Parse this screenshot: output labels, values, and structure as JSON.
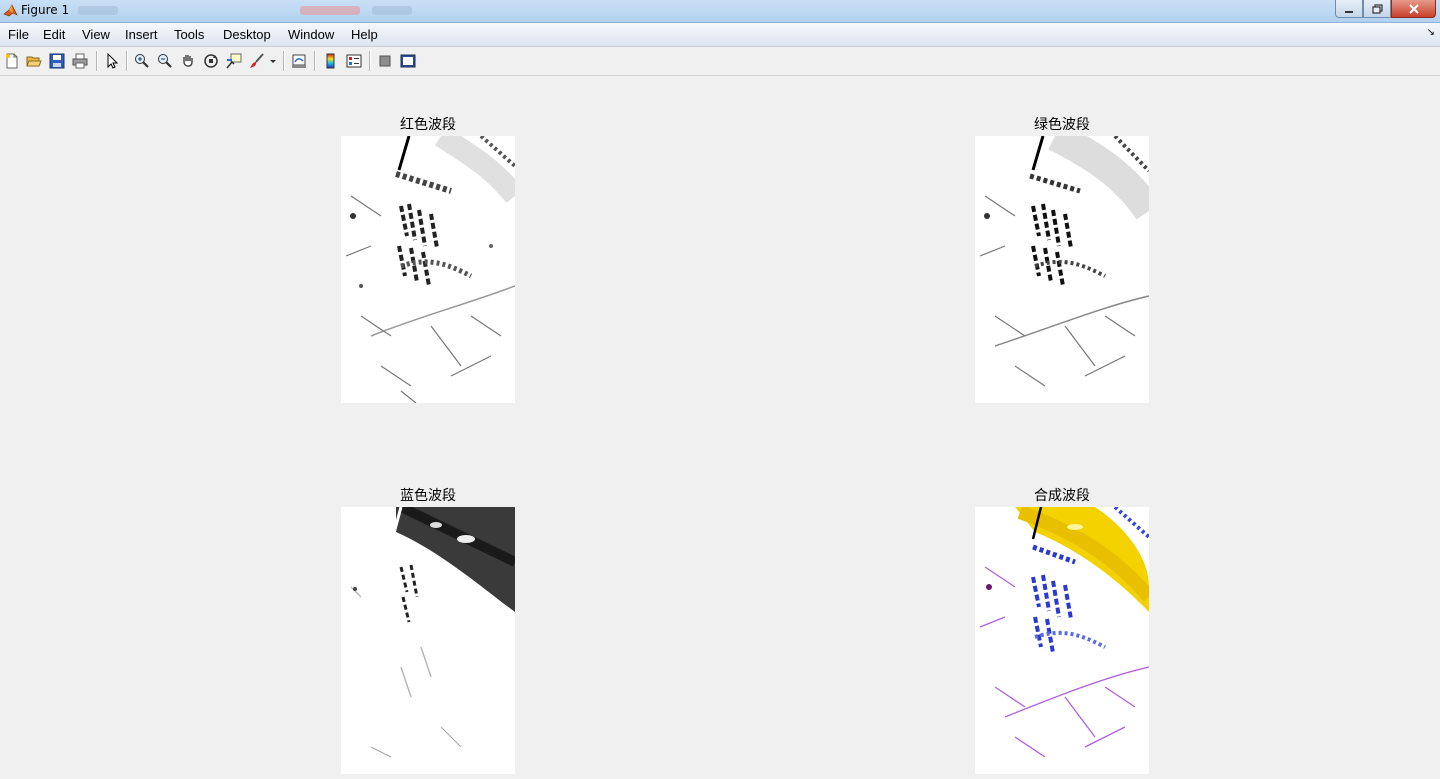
{
  "window": {
    "title": "Figure 1"
  },
  "menu": [
    "File",
    "Edit",
    "View",
    "Insert",
    "Tools",
    "Desktop",
    "Window",
    "Help"
  ],
  "toolbar": {
    "buttons": [
      "new-figure-icon",
      "open-file-icon",
      "save-icon",
      "print-icon",
      "edit-plot-arrow-icon",
      "zoom-in-icon",
      "zoom-out-icon",
      "pan-hand-icon",
      "rotate-3d-icon",
      "data-cursor-icon",
      "brush-icon",
      "link-plot-icon",
      "colorbar-icon",
      "legend-icon",
      "hide-plot-tools-icon",
      "show-plot-tools-icon"
    ]
  },
  "axes": [
    {
      "title": "红色波段",
      "band": "red"
    },
    {
      "title": "绿色波段",
      "band": "green"
    },
    {
      "title": "蓝色波段",
      "band": "blue"
    },
    {
      "title": "合成波段",
      "band": "composite"
    }
  ]
}
